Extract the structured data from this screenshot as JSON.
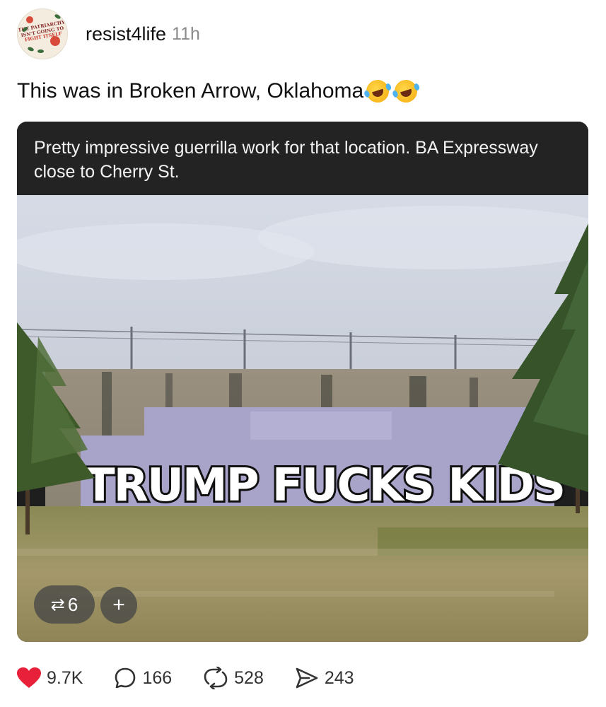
{
  "post": {
    "username": "resist4life",
    "timestamp": "11h",
    "caption": "This was in Broken Arrow, Oklahoma",
    "caption_emojis": [
      "rolling-on-floor-laughing-emoji",
      "rolling-on-floor-laughing-emoji"
    ]
  },
  "avatar": {
    "text_line1": "THE PATRIARCHY",
    "text_line2": "ISN'T GOING TO",
    "text_line3": "FIGHT ITSELF"
  },
  "media": {
    "banner_text": "Pretty impressive guerrilla work for that location. BA Expressway close to Cherry St.",
    "graffiti_text": "TRUMP FUCKS KIDS",
    "repost_count": "6",
    "repost_icon": "repost-icon",
    "add_label": "+"
  },
  "actions": {
    "likes": "9.7K",
    "comments": "166",
    "reposts": "528",
    "shares": "243",
    "like_color": "#e8203a"
  }
}
